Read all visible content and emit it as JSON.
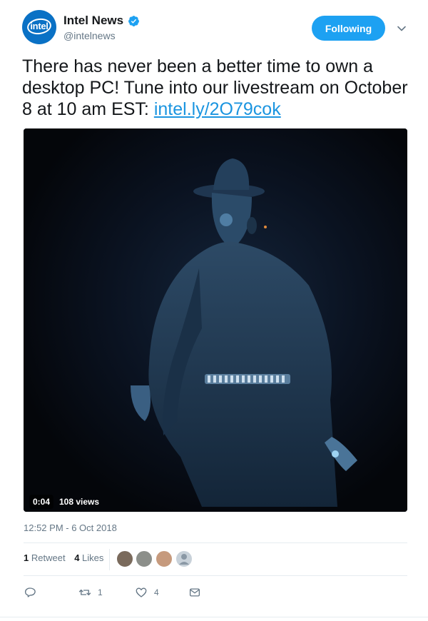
{
  "header": {
    "display_name": "Intel News",
    "handle": "@intelnews",
    "avatar_logo_text": "intel",
    "follow_label": "Following"
  },
  "tweet": {
    "text_before_link": "There has never been a better time to own a desktop PC! Tune into our livestream on October 8 at 10 am EST: ",
    "link_text": "intel.ly/2O79cok"
  },
  "video": {
    "elapsed": "0:04",
    "views": "108 views"
  },
  "timestamp": "12:52 PM - 6 Oct 2018",
  "stats": {
    "retweets_count": "1",
    "retweets_label": "Retweet",
    "likes_count": "4",
    "likes_label": "Likes"
  },
  "actions": {
    "reply_count": "",
    "retweet_count": "1",
    "like_count": "4"
  },
  "colors": {
    "accent": "#1da1f2",
    "link": "#1b95e0",
    "muted": "#657786",
    "avatar": "#0a71c5"
  },
  "icons": [
    "verified-badge-icon",
    "chevron-down-icon",
    "reply-icon",
    "retweet-icon",
    "heart-icon",
    "message-icon"
  ]
}
